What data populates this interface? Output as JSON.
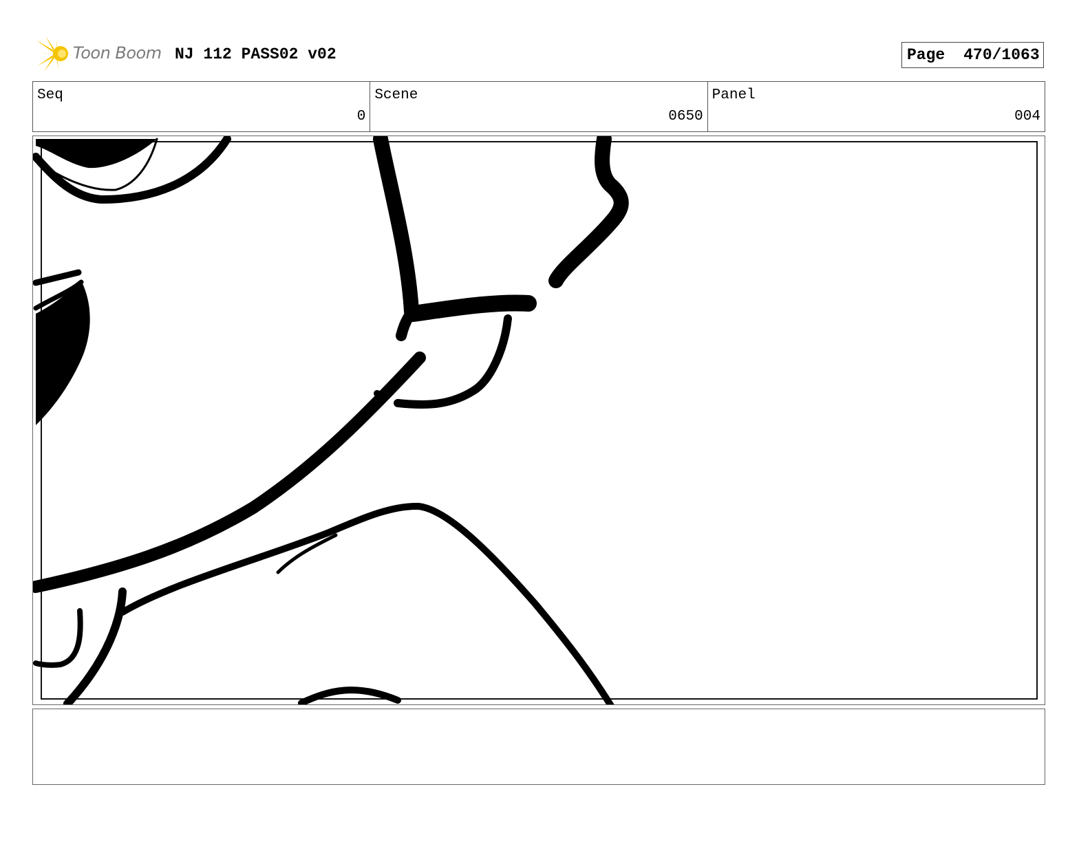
{
  "header": {
    "logo_text": "Toon Boom",
    "project_title": "NJ 112 PASS02 v02",
    "page_label": "Page",
    "page_number": "470/1063"
  },
  "info": {
    "seq_label": "Seq",
    "seq_value": "0",
    "scene_label": "Scene",
    "scene_value": "0650",
    "panel_label": "Panel",
    "panel_value": "004"
  },
  "notes": {
    "text": ""
  },
  "colors": {
    "logo_star": "#f5c400",
    "logo_text": "#7a7a7a",
    "ink": "#000000"
  }
}
